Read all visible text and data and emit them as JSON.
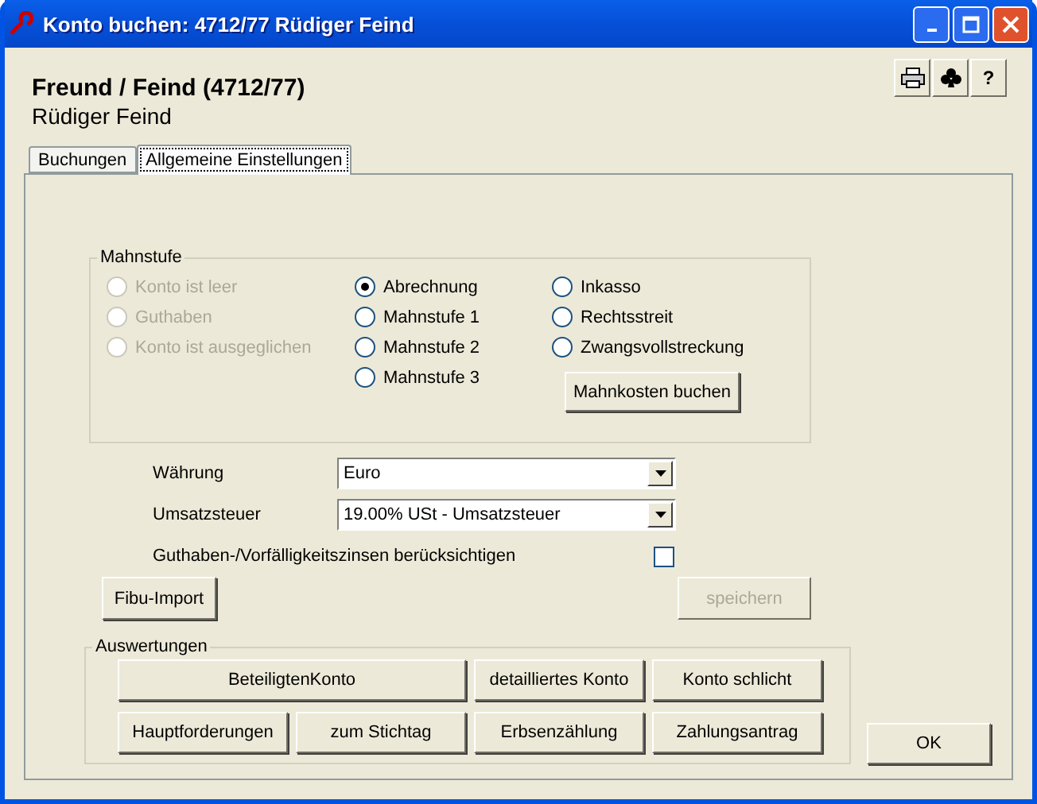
{
  "window": {
    "title": "Konto buchen: 4712/77 Rüdiger Feind"
  },
  "header": {
    "title": "Freund / Feind (4712/77)",
    "subtitle": "Rüdiger Feind"
  },
  "toolbar": [
    {
      "kind": "print"
    },
    {
      "kind": "club"
    },
    {
      "kind": "text",
      "label": "?"
    }
  ],
  "tabs": [
    {
      "label": "Buchungen",
      "selected": false
    },
    {
      "label": "Allgemeine Einstellungen",
      "selected": true
    }
  ],
  "mahnstufe": {
    "title": "Mahnstufe",
    "columns": [
      [
        {
          "label": "Konto ist leer",
          "selected": false,
          "disabled": true
        },
        {
          "label": "Guthaben",
          "selected": false,
          "disabled": true
        },
        {
          "label": "Konto ist ausgeglichen",
          "selected": false,
          "disabled": true
        }
      ],
      [
        {
          "label": "Abrechnung",
          "selected": true,
          "disabled": false
        },
        {
          "label": "Mahnstufe 1",
          "selected": false,
          "disabled": false
        },
        {
          "label": "Mahnstufe 2",
          "selected": false,
          "disabled": false
        },
        {
          "label": "Mahnstufe 3",
          "selected": false,
          "disabled": false
        }
      ],
      [
        {
          "label": "Inkasso",
          "selected": false,
          "disabled": false
        },
        {
          "label": "Rechtsstreit",
          "selected": false,
          "disabled": false
        },
        {
          "label": "Zwangsvollstreckung",
          "selected": false,
          "disabled": false
        }
      ]
    ],
    "button": "Mahnkosten buchen"
  },
  "fields": [
    {
      "label": "Währung",
      "value": "Euro"
    },
    {
      "label": "Umsatzsteuer",
      "value": "19.00% USt - Umsatzsteuer"
    }
  ],
  "zinsen": {
    "label": "Guthaben-/Vorfälligkeitszinsen berücksichtigen",
    "checked": false
  },
  "fibu_button": {
    "label": "Fibu-Import",
    "disabled": false
  },
  "save_button": {
    "label": "speichern",
    "disabled": true
  },
  "auswertungen": {
    "title": "Auswertungen",
    "buttons": [
      "BeteiligtenKonto",
      "detailliertes Konto",
      "Konto schlicht",
      "Hauptforderungen",
      "zum Stichtag",
      "Erbsenzählung",
      "Zahlungsantrag"
    ]
  },
  "ok_button": "OK"
}
